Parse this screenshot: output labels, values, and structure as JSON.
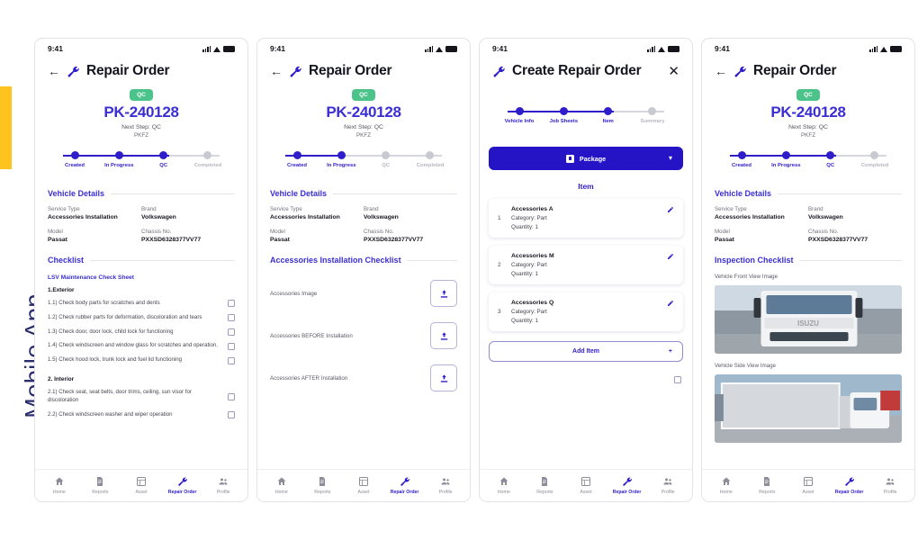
{
  "rail": {
    "label": "Mobile App",
    "accent_color": "#FFC31F",
    "text_color": "#2A2C6B"
  },
  "theme": {
    "primary": "#2E1DC9",
    "primary_deep": "#2414C6",
    "accent_blue": "#3B2FD4",
    "green": "#4CC38A",
    "muted": "#b6b6c0"
  },
  "status_bar": {
    "time": "9:41"
  },
  "order": {
    "badge": "QC",
    "id": "PK-240128",
    "next_step": "Next Step: QC",
    "org": "PKFZ"
  },
  "vehicle_details": {
    "heading": "Vehicle Details",
    "fields": [
      {
        "label": "Service Type",
        "value": "Accessories Installation"
      },
      {
        "label": "Brand",
        "value": "Volkswagen"
      },
      {
        "label": "Model",
        "value": "Passat"
      },
      {
        "label": "Chassis No.",
        "value": "PXXSD6328377VV77"
      }
    ]
  },
  "screen1": {
    "title": "Repair Order",
    "steps": [
      {
        "label": "Created",
        "active": true
      },
      {
        "label": "In Progress",
        "active": true
      },
      {
        "label": "QC",
        "active": true
      },
      {
        "label": "Completed",
        "active": false
      }
    ],
    "fill_percent": 66,
    "checklist_heading": "Checklist",
    "sheet_title": "LSV Maintenance Check Sheet",
    "groups": [
      {
        "title": "1.Exterior",
        "items": [
          "1.1) Check body parts for scratches and dents",
          "1.2) Check rubber parts for deformation, discoloration and tears",
          "1.3) Check door, door lock, child lock for functioning",
          "1.4) Check windscreen and window glass for scratches and operation.",
          "1.5) Check hood lock, trunk lock and fuel lid functioning"
        ]
      },
      {
        "title": "2. Interior",
        "items": [
          "2.1) Check seat, seat belts, door trims, ceiling, sun visor for discoloration",
          "2.2) Check windscreen washer and wiper operation"
        ]
      }
    ]
  },
  "screen2": {
    "title": "Repair Order",
    "steps": [
      {
        "label": "Created",
        "active": true
      },
      {
        "label": "In Progress",
        "active": true
      },
      {
        "label": "QC",
        "active": false
      },
      {
        "label": "Completed",
        "active": false
      }
    ],
    "fill_percent": 33,
    "checklist_heading": "Accessories Installation Checklist",
    "uploads": [
      {
        "label": "Accessories Image",
        "icon": "upload-icon"
      },
      {
        "label": "Accessories BEFORE Installation",
        "icon": "upload-icon"
      },
      {
        "label": "Accessories AFTER Installation",
        "icon": "upload-icon"
      }
    ]
  },
  "screen3": {
    "title": "Create Repair Order",
    "steps": [
      {
        "label": "Vehicle Info",
        "active": true
      },
      {
        "label": "Job Sheets",
        "active": true
      },
      {
        "label": "Item",
        "active": true
      },
      {
        "label": "Summary",
        "active": false
      }
    ],
    "fill_percent": 66,
    "package_button": "Package",
    "item_heading": "Item",
    "items": [
      {
        "num": "1",
        "name": "Accessories A",
        "category": "Category: Part",
        "quantity": "Quantity: 1"
      },
      {
        "num": "2",
        "name": "Accessories M",
        "category": "Category: Part",
        "quantity": "Quantity: 1"
      },
      {
        "num": "3",
        "name": "Accessories Q",
        "category": "Category: Part",
        "quantity": "Quantity: 1"
      }
    ],
    "add_item": "Add Item"
  },
  "screen4": {
    "title": "Repair Order",
    "steps": [
      {
        "label": "Created",
        "active": true
      },
      {
        "label": "In Progress",
        "active": true
      },
      {
        "label": "QC",
        "active": true
      },
      {
        "label": "Completed",
        "active": false
      }
    ],
    "fill_percent": 66,
    "heading": "Inspection Checklist",
    "photos": [
      {
        "label": "Vehicle Front View Image",
        "alt": "isuzu-truck-front-view"
      },
      {
        "label": "Vehicle Side View Image",
        "alt": "white-box-truck-side-view"
      }
    ]
  },
  "bottom_nav": [
    {
      "label": "Home",
      "icon": "home-icon",
      "active": false
    },
    {
      "label": "Reports",
      "icon": "document-icon",
      "active": false
    },
    {
      "label": "Asset",
      "icon": "grid-icon",
      "active": false
    },
    {
      "label": "Repair Order",
      "icon": "wrench-icon",
      "active": true
    },
    {
      "label": "Profile",
      "icon": "people-icon",
      "active": false
    }
  ]
}
